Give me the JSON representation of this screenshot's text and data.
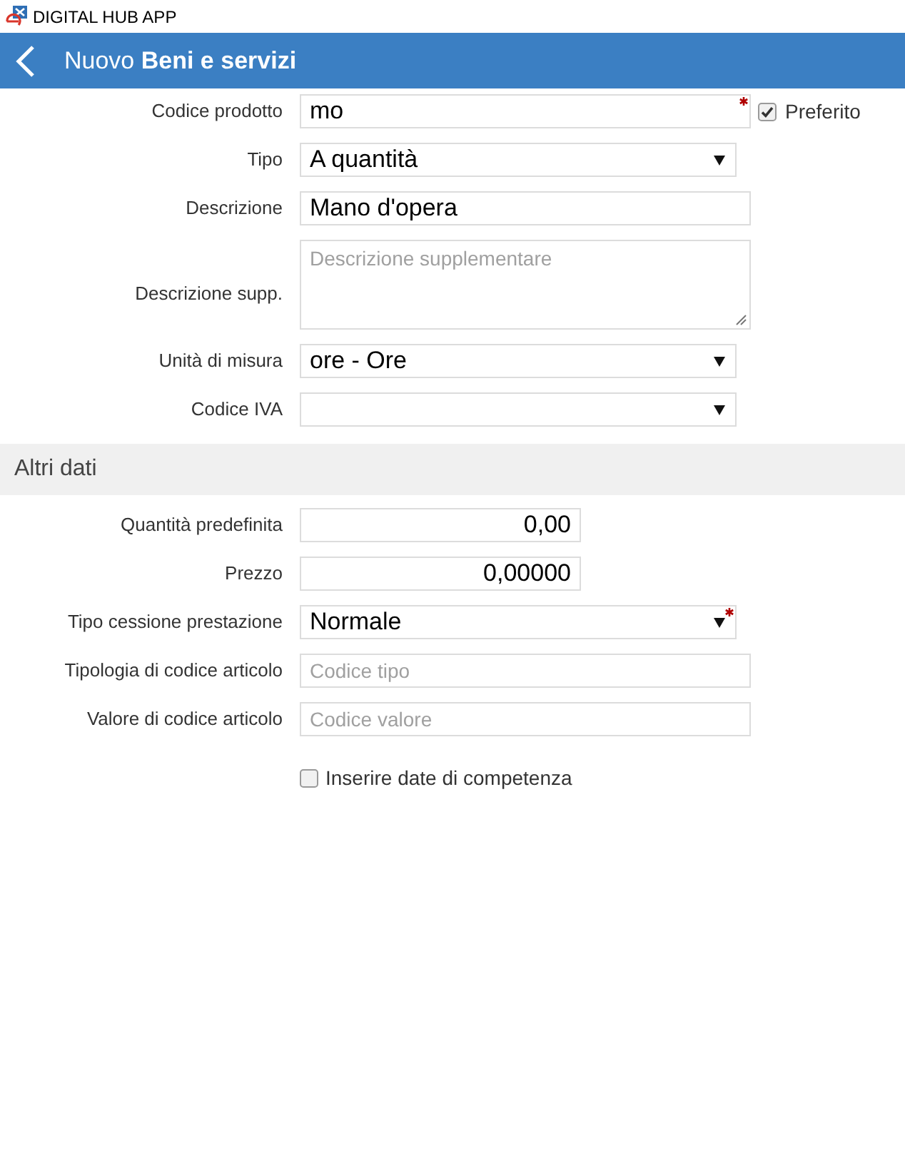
{
  "window": {
    "title": "DIGITAL HUB APP"
  },
  "header": {
    "title": "Nuovo **Beni e servizi**"
  },
  "sections": [
    {
      "fields": [
        {
          "kind": "text",
          "label": "Codice prodotto",
          "value": "mo",
          "required": true,
          "checkbox": {
            "label": "Preferito",
            "checked": true
          }
        },
        {
          "kind": "select",
          "label": "Tipo",
          "value": "A quantità",
          "required": false
        },
        {
          "kind": "text",
          "label": "Descrizione",
          "value": "Mano d'opera",
          "required": false
        },
        {
          "kind": "textarea",
          "label": "Descrizione supp.",
          "placeholder": "Descrizione supplementare",
          "required": false
        },
        {
          "kind": "select",
          "label": "Unità di misura",
          "value": "ore - Ore",
          "required": false
        },
        {
          "kind": "select",
          "label": "Codice IVA",
          "required": false
        }
      ]
    },
    {
      "title": "Altri dati",
      "fields": [
        {
          "kind": "number",
          "label": "Quantità predefinita",
          "value": "0,00",
          "required": false
        },
        {
          "kind": "number",
          "label": "Prezzo",
          "value": "0,00000",
          "required": false
        },
        {
          "kind": "select",
          "label": "Tipo cessione prestazione",
          "value": "Normale",
          "required": true
        },
        {
          "kind": "text",
          "label": "Tipologia di codice articolo",
          "placeholder": "Codice tipo",
          "required": false
        },
        {
          "kind": "text",
          "label": "Valore di codice articolo",
          "placeholder": "Codice valore",
          "required": false
        },
        {
          "kind": "checkbox",
          "label": "Inserire date di competenza",
          "checked": false
        }
      ]
    }
  ]
}
